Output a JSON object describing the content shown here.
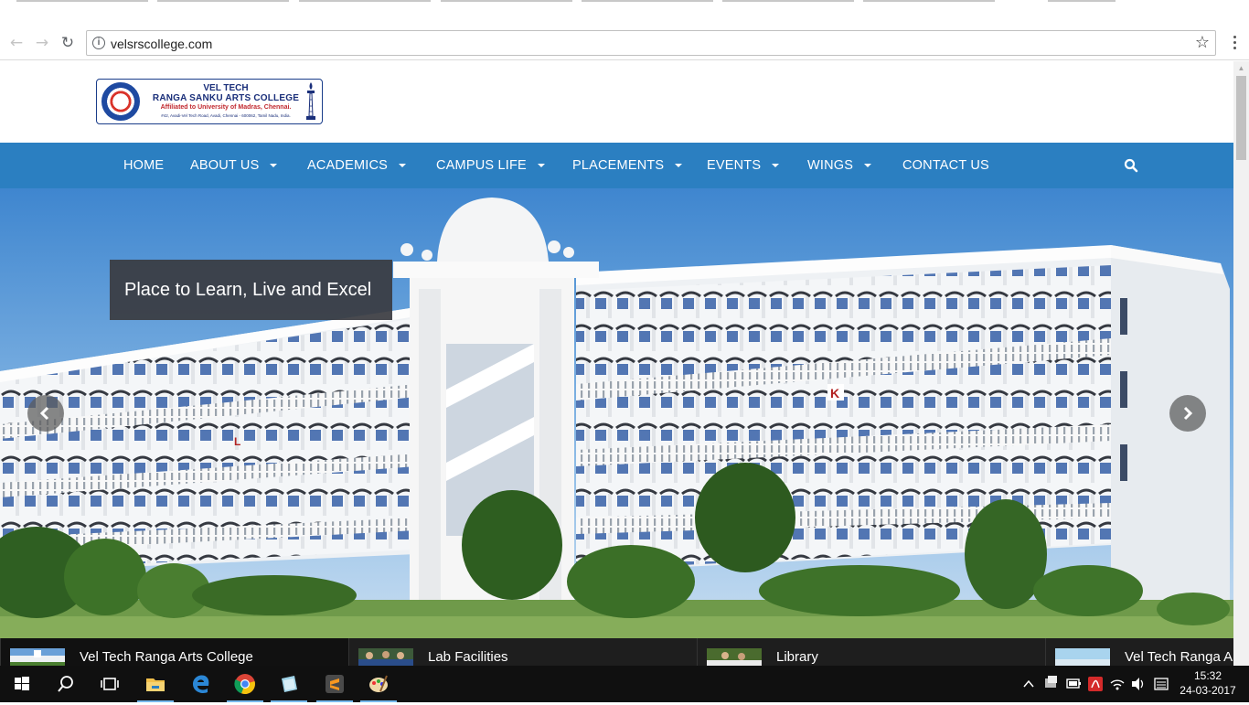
{
  "browser": {
    "url": "velsrscollege.com",
    "back_icon": "back-arrow-icon",
    "forward_icon": "forward-arrow-icon",
    "reload_icon": "reload-icon",
    "bookmark_icon": "star-icon"
  },
  "logo": {
    "line1": "VEL TECH",
    "line2": "RANGA SANKU ARTS COLLEGE",
    "line3": "Affiliated to University of Madras, Chennai.",
    "line4": "#42, Avadi-Vel Tech Road, Avadi, Chennai - 600062, Tamil Nadu, India."
  },
  "nav": {
    "items": [
      {
        "label": "HOME",
        "dropdown": false
      },
      {
        "label": "ABOUT US",
        "dropdown": true
      },
      {
        "label": "ACADEMICS",
        "dropdown": true
      },
      {
        "label": "CAMPUS LIFE",
        "dropdown": true
      },
      {
        "label": "PLACEMENTS",
        "dropdown": true
      },
      {
        "label": "EVENTS",
        "dropdown": true
      },
      {
        "label": "WINGS",
        "dropdown": true
      },
      {
        "label": "CONTACT US",
        "dropdown": false
      }
    ],
    "search_icon": "search-icon",
    "background": "#2b7fc1"
  },
  "hero": {
    "caption": "Place to Learn, Live and Excel",
    "prev_icon": "chevron-left-icon",
    "next_icon": "chevron-right-icon"
  },
  "thumbnails": [
    {
      "label": "Vel Tech Ranga Arts College"
    },
    {
      "label": "Lab Facilities"
    },
    {
      "label": "Library"
    },
    {
      "label": "Vel Tech Ranga A"
    }
  ],
  "taskbar": {
    "apps": [
      "windows-start-icon",
      "search-icon",
      "task-view-icon",
      "file-explorer-icon",
      "edge-icon",
      "chrome-icon",
      "app-icon",
      "sublime-text-icon",
      "paint-icon"
    ],
    "time": "15:32",
    "date": "24-03-2017"
  }
}
